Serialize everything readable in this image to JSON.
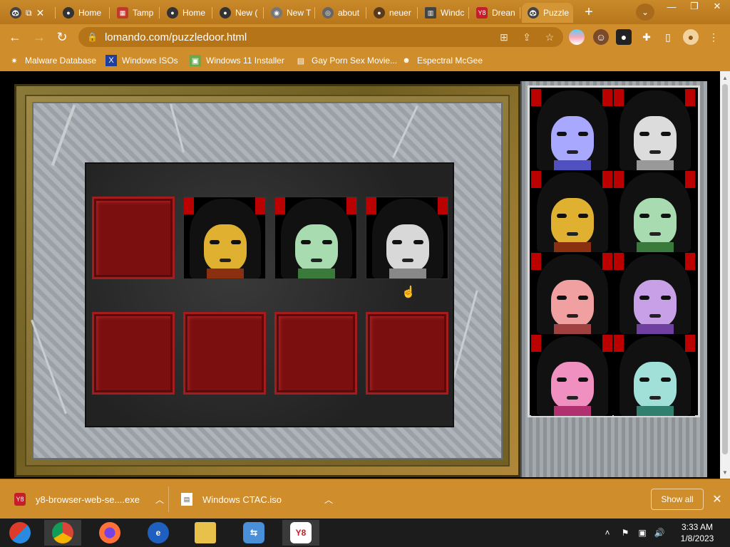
{
  "browser": {
    "tabs": [
      {
        "label": "",
        "icon": "panda-icon",
        "active": false
      },
      {
        "label": "Home",
        "icon": "panda-icon",
        "active": false
      },
      {
        "label": "Tamp",
        "icon": "tampermonkey-icon",
        "active": false
      },
      {
        "label": "Home",
        "icon": "panda-icon",
        "active": false
      },
      {
        "label": "New (",
        "icon": "panda-icon",
        "active": false
      },
      {
        "label": "New T",
        "icon": "chrome-icon",
        "active": false
      },
      {
        "label": "about",
        "icon": "globe-icon",
        "active": false
      },
      {
        "label": "neuer",
        "icon": "site-icon",
        "active": false
      },
      {
        "label": "Windc",
        "icon": "archive-icon",
        "active": false
      },
      {
        "label": "Drean",
        "icon": "y8-icon",
        "active": false
      },
      {
        "label": "Puzzle",
        "icon": "panda-icon",
        "active": true
      }
    ],
    "new_tab_symbol": "+",
    "url": "lomando.com/puzzledoor.html",
    "bookmarks": [
      {
        "label": "Malware Database",
        "icon": "bug-icon"
      },
      {
        "label": "Windows ISOs",
        "icon": "x-icon"
      },
      {
        "label": "Windows 11 Installer",
        "icon": "image-icon"
      },
      {
        "label": "Gay Porn Sex Movie...",
        "icon": "computer-icon"
      },
      {
        "label": "Espectral McGee",
        "icon": "character-icon"
      }
    ]
  },
  "puzzle": {
    "board_tiles": [
      {
        "type": "empty"
      },
      {
        "type": "face",
        "color": "#e0b030",
        "collar": "#8a3010"
      },
      {
        "type": "face",
        "color": "#a8dcb0",
        "collar": "#3a7a3a"
      },
      {
        "type": "face",
        "color": "#d8d8d8",
        "collar": "#888888"
      },
      {
        "type": "empty"
      },
      {
        "type": "empty"
      },
      {
        "type": "empty"
      },
      {
        "type": "empty"
      }
    ],
    "palette": [
      {
        "color": "#a8a8ff",
        "collar": "#5050c0"
      },
      {
        "color": "#dcdcdc",
        "collar": "#999999"
      },
      {
        "color": "#e0b030",
        "collar": "#8a3010"
      },
      {
        "color": "#a8dcb0",
        "collar": "#3a7a3a"
      },
      {
        "color": "#f0a0a0",
        "collar": "#a04040"
      },
      {
        "color": "#c8a0e8",
        "collar": "#7040a0"
      },
      {
        "color": "#f090c0",
        "collar": "#b03070"
      },
      {
        "color": "#a0e0d8",
        "collar": "#308070"
      }
    ]
  },
  "downloads": {
    "items": [
      {
        "name": "y8-browser-web-se....exe",
        "icon": "y8-icon"
      },
      {
        "name": "Windows CTAC.iso",
        "icon": "file-icon"
      }
    ],
    "show_all": "Show all"
  },
  "taskbar": {
    "apps": [
      "Start",
      "Chrome",
      "Firefox",
      "Internet Explorer",
      "File Explorer",
      "Network",
      "Y8 Browser"
    ],
    "time": "3:33 AM",
    "date": "1/8/2023"
  }
}
